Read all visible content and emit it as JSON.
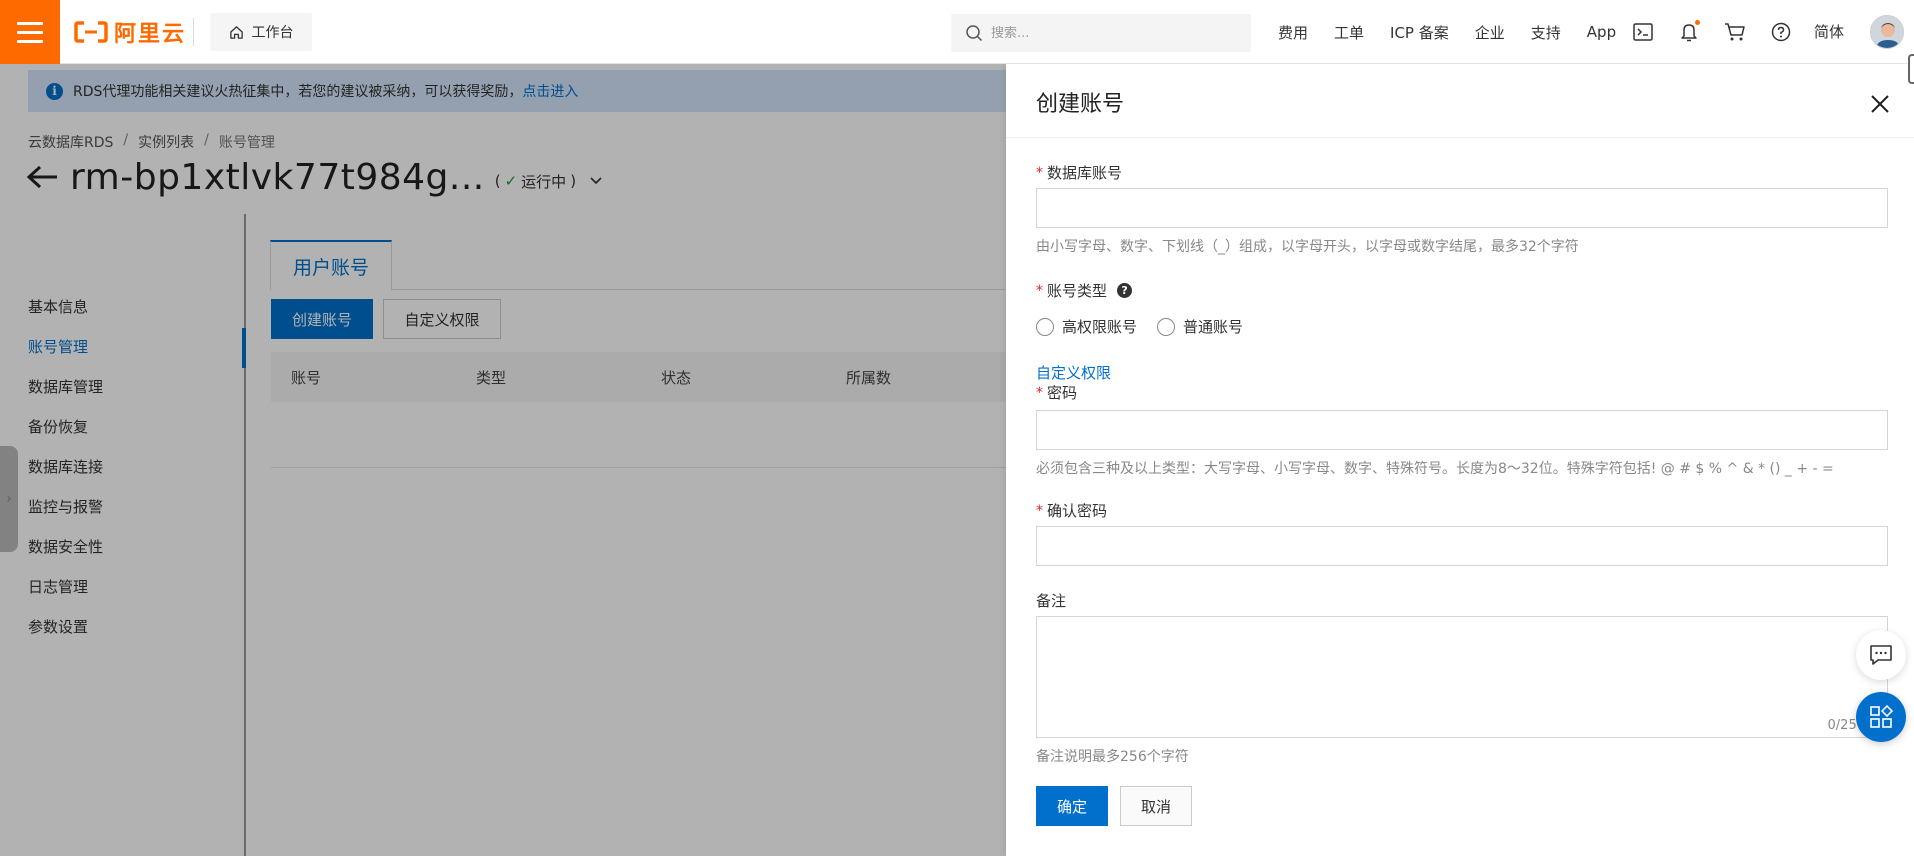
{
  "topbar": {
    "logo_text": "阿里云",
    "workbench_label": "工作台",
    "search_placeholder": "搜索...",
    "nav": [
      "费用",
      "工单",
      "ICP 备案",
      "企业",
      "支持",
      "App"
    ],
    "lang_label": "简体",
    "brand_color": "#ff6a00"
  },
  "notice": {
    "text": "RDS代理功能相关建议火热征集中，若您的建议被采纳，可以获得奖励，",
    "link": "点击进入"
  },
  "breadcrumb": [
    "云数据库RDS",
    "实例列表",
    "账号管理"
  ],
  "instance": {
    "title": "rm-bp1xtlvk77t984g...",
    "status_open": "(",
    "status": "运行中",
    "status_close": ")"
  },
  "leftnav": [
    "基本信息",
    "账号管理",
    "数据库管理",
    "备份恢复",
    "数据库连接",
    "监控与报警",
    "数据安全性",
    "日志管理",
    "参数设置"
  ],
  "tabs": {
    "user_accounts": "用户账号"
  },
  "actions": {
    "create": "创建账号",
    "custom": "自定义权限"
  },
  "table": {
    "headers": [
      "账号",
      "类型",
      "状态",
      "所属数"
    ]
  },
  "drawer": {
    "title": "创建账号",
    "account_label": "数据库账号",
    "account_hint": "由小写字母、数字、下划线（_）组成，以字母开头，以字母或数字结尾，最多32个字符",
    "type_label": "账号类型",
    "type_options": [
      "高权限账号",
      "普通账号"
    ],
    "custom_link": "自定义权限",
    "password_label": "密码",
    "password_hint": "必须包含三种及以上类型：大写字母、小写字母、数字、特殊符号。长度为8～32位。特殊字符包括! @ # $ % ^ & * () _ + - =",
    "confirm_label": "确认密码",
    "remark_label": "备注",
    "remark_counter": "0/256",
    "remark_hint": "备注说明最多256个字符",
    "ok": "确定",
    "cancel": "取消",
    "required_mark": "*",
    "accent_color": "#0070cc"
  }
}
